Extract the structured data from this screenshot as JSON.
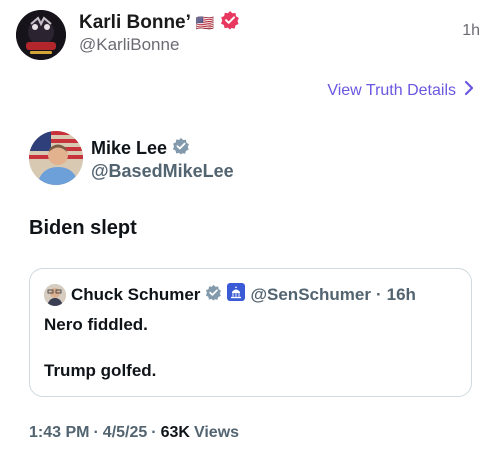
{
  "outer_post": {
    "display_name": "Karli Bonne’",
    "flag_emoji": "🇺🇸",
    "handle": "@KarliBonne",
    "time": "1h",
    "view_details_label": "View Truth Details",
    "verified_color": "#e8385f",
    "accent_color": "#6a57e0"
  },
  "embedded_post": {
    "display_name": "Mike Lee",
    "handle": "@BasedMikeLee",
    "text": "Biden slept",
    "quote": {
      "display_name": "Chuck Schumer",
      "handle": "@SenSchumer",
      "separator": "·",
      "time": "16h",
      "line1": "Nero fiddled.",
      "line2": "Trump golfed."
    },
    "meta": {
      "time": "1:43 PM",
      "sep1": "·",
      "date": "4/5/25",
      "sep2": "·",
      "views_count": "63K",
      "views_label": "Views"
    }
  }
}
